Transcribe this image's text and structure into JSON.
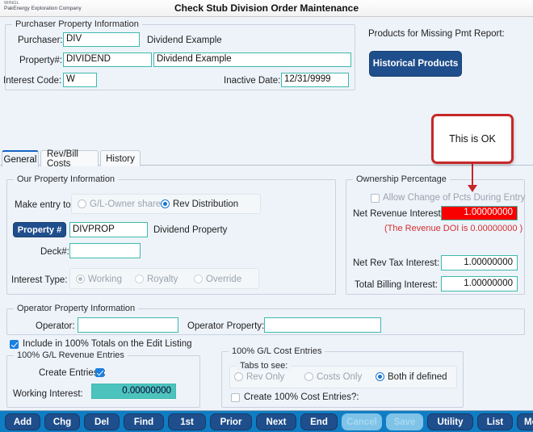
{
  "titlebar": {
    "brand_line1": "WINGL",
    "brand_line2": "PakEnergy Exploration Company",
    "title": "Check Stub Division Order Maintenance"
  },
  "purchaser_group": {
    "legend": "Purchaser Property Information",
    "purchaser_label": "Purchaser:",
    "purchaser_value": "DIV",
    "purchaser_desc": "Dividend Example",
    "property_label": "Property#:",
    "property_value": "DIVIDEND",
    "property_desc": "Dividend Example",
    "interest_code_label": "Interest Code:",
    "interest_code_value": "W",
    "inactive_date_label": "Inactive Date:",
    "inactive_date_value": "12/31/9999"
  },
  "missing_pmt": {
    "label": "Products for Missing Pmt Report:",
    "button_label": "Historical Products"
  },
  "callout": {
    "text": "This is OK"
  },
  "tabs": [
    {
      "label": "General",
      "active": true
    },
    {
      "label": "Rev/Bill Costs",
      "active": false
    },
    {
      "label": "History",
      "active": false
    }
  ],
  "our_property": {
    "legend": "Our Property Information",
    "make_entry_label": "Make entry to:",
    "option_gl": "G/L-Owner share",
    "option_rev": "Rev Distribution",
    "selected_entry": "Rev Distribution",
    "property_button": "Property #",
    "property_value": "DIVPROP",
    "property_desc": "Dividend Property",
    "deck_label": "Deck#:",
    "deck_value": "",
    "interest_type_label": "Interest Type:",
    "interest_type_options": [
      "Working",
      "Royalty",
      "Override"
    ],
    "interest_type_selected": "Working"
  },
  "ownership": {
    "legend": "Ownership Percentage",
    "allow_change_label": "Allow Change of Pcts During Entry",
    "allow_change_checked": false,
    "net_revenue_label": "Net Revenue Interest:",
    "net_revenue_value": "1.00000000",
    "doi_note": "(The Revenue DOI is 0.00000000 )",
    "net_rev_tax_label": "Net Rev Tax Interest:",
    "net_rev_tax_value": "1.00000000",
    "total_billing_label": "Total Billing Interest:",
    "total_billing_value": "1.00000000",
    "alert_color": "#f90000"
  },
  "operator_group": {
    "legend": "Operator Property Information",
    "operator_label": "Operator:",
    "operator_value": "",
    "operator_property_label": "Operator Property:",
    "operator_property_value": ""
  },
  "include_totals": {
    "label": "Include in 100% Totals on the Edit Listing",
    "checked": true
  },
  "revenue_entries": {
    "legend": "100% G/L Revenue Entries",
    "create_entries_label": "Create Entries?:",
    "create_entries_checked": true,
    "working_interest_label": "Working Interest:",
    "working_interest_value": "0.00000000"
  },
  "cost_entries": {
    "legend": "100% G/L Cost Entries",
    "tabs_to_see_legend": "Tabs to see:",
    "options": [
      "Rev Only",
      "Costs Only",
      "Both if defined"
    ],
    "selected": "Both if defined",
    "create_cost_label": "Create 100% Cost Entries?:",
    "create_cost_checked": false
  },
  "buttonbar": [
    {
      "label": "Add",
      "accel": "A",
      "disabled": false
    },
    {
      "label": "Chg",
      "accel": "C",
      "disabled": false
    },
    {
      "label": "Del",
      "accel": "D",
      "disabled": false
    },
    {
      "label": "Find",
      "accel": "F",
      "disabled": false
    },
    {
      "label": "1st",
      "accel": "1",
      "disabled": false
    },
    {
      "label": "Prior",
      "accel": "P",
      "disabled": false
    },
    {
      "label": "Next",
      "accel": "N",
      "disabled": false
    },
    {
      "label": "End",
      "accel": "E",
      "disabled": false
    },
    {
      "label": "Cancel",
      "accel": "C",
      "disabled": true
    },
    {
      "label": "Save",
      "accel": "S",
      "disabled": true
    },
    {
      "label": "Utility",
      "accel": "U",
      "disabled": false
    },
    {
      "label": "List",
      "accel": "L",
      "disabled": false
    },
    {
      "label": "Menu",
      "accel": "M",
      "disabled": false
    }
  ]
}
